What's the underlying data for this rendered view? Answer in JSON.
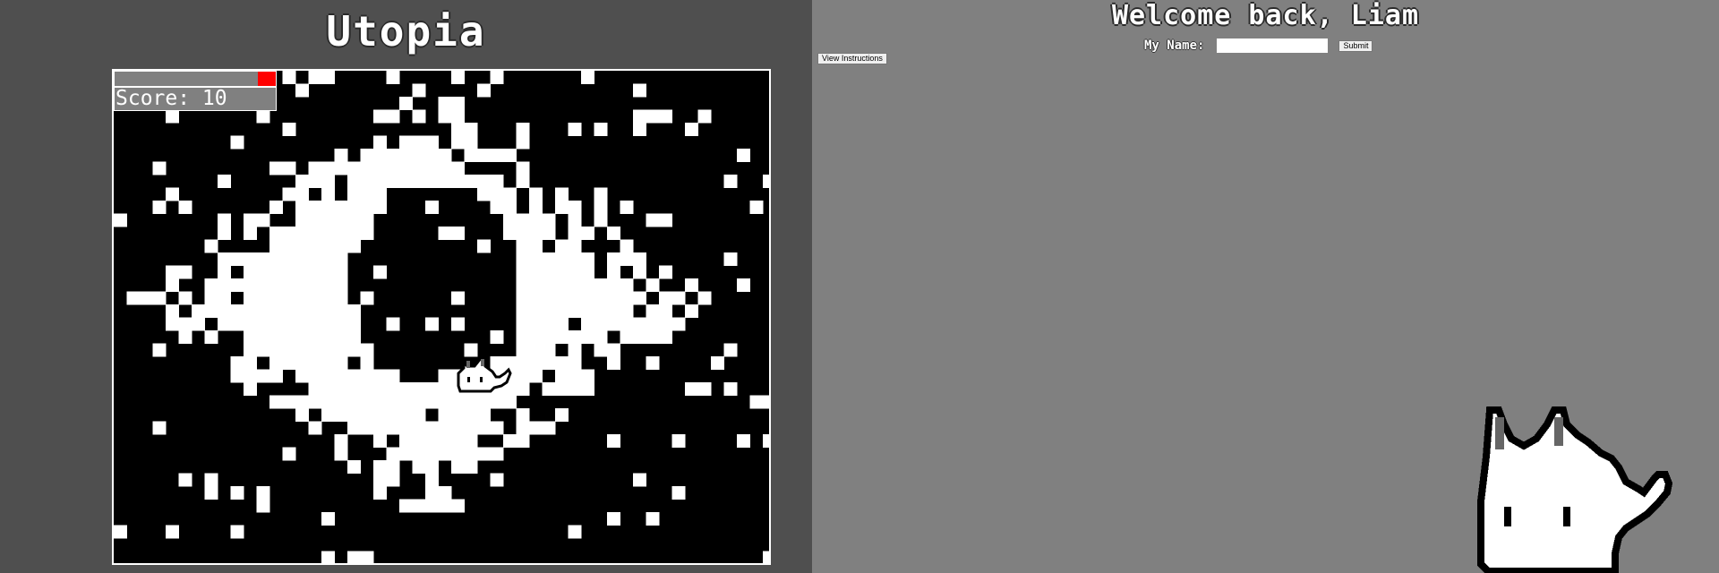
{
  "game": {
    "title": "Utopia",
    "score_text": "Score: 10",
    "health_fraction": 0.11
  },
  "account": {
    "welcome": "Welcome back, Liam",
    "name_label": "My Name:",
    "name_value": "",
    "submit_label": "Submit",
    "instructions_label": "View Instructions"
  },
  "colors": {
    "left_panel": "#4f4f4f",
    "right_panel": "#808080",
    "wall": "#000000",
    "floor": "#ffffff",
    "health": "#ff0000"
  },
  "icons": {
    "player": "cat-sprite",
    "mascot": "cat-mascot"
  }
}
